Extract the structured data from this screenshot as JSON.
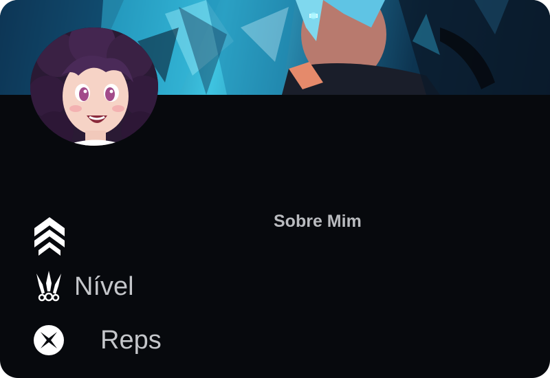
{
  "profile": {
    "about_heading": "Sobre Mim",
    "level_label": "Nível",
    "reps_label": "Reps"
  },
  "icons": {
    "rank": "rank-chevrons-icon",
    "level": "kunai-icon",
    "reps": "x-circle-icon"
  },
  "colors": {
    "card_background": "#07090d",
    "text": "#c4c6ca",
    "heading": "#b9bbbf",
    "banner_accent": "#3ec3e0"
  }
}
